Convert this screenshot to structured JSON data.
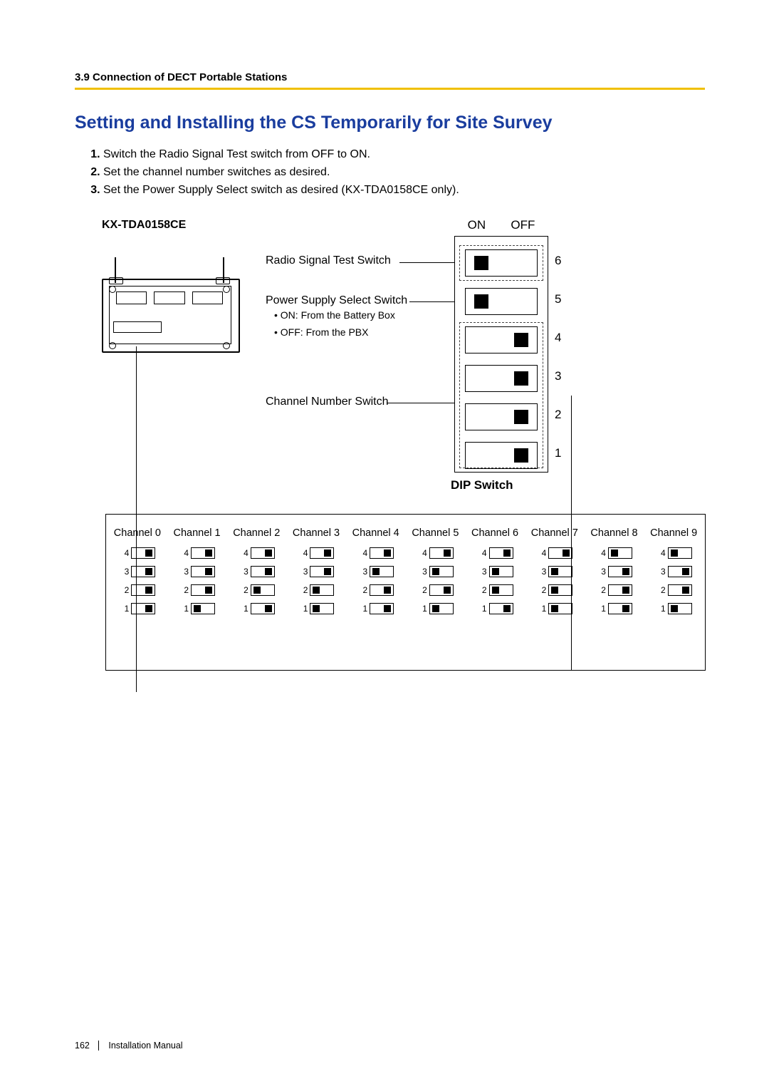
{
  "header": "3.9 Connection of DECT Portable Stations",
  "title": "Setting and Installing the CS Temporarily for Site Survey",
  "steps": [
    "Switch the Radio Signal Test switch from OFF to ON.",
    "Set the channel number switches as desired.",
    "Set the Power Supply Select switch as desired (KX-TDA0158CE only)."
  ],
  "model": "KX-TDA0158CE",
  "dip": {
    "on": "ON",
    "off": "OFF",
    "title": "DIP Switch",
    "radio_label": "Radio Signal Test Switch",
    "power_label": "Power Supply Select Switch",
    "power_sub1": "ON: From the Battery Box",
    "power_sub2": "OFF: From the PBX",
    "channel_label": "Channel Number Switch",
    "nums": {
      "1": "1",
      "2": "2",
      "3": "3",
      "4": "4",
      "5": "5",
      "6": "6"
    }
  },
  "channels": [
    {
      "name": "Channel 0",
      "sw": {
        "4": "off",
        "3": "off",
        "2": "off",
        "1": "off"
      }
    },
    {
      "name": "Channel 1",
      "sw": {
        "4": "off",
        "3": "off",
        "2": "off",
        "1": "on"
      }
    },
    {
      "name": "Channel 2",
      "sw": {
        "4": "off",
        "3": "off",
        "2": "on",
        "1": "off"
      }
    },
    {
      "name": "Channel 3",
      "sw": {
        "4": "off",
        "3": "off",
        "2": "on",
        "1": "on"
      }
    },
    {
      "name": "Channel 4",
      "sw": {
        "4": "off",
        "3": "on",
        "2": "off",
        "1": "off"
      }
    },
    {
      "name": "Channel 5",
      "sw": {
        "4": "off",
        "3": "on",
        "2": "off",
        "1": "on"
      }
    },
    {
      "name": "Channel 6",
      "sw": {
        "4": "off",
        "3": "on",
        "2": "on",
        "1": "off"
      }
    },
    {
      "name": "Channel 7",
      "sw": {
        "4": "off",
        "3": "on",
        "2": "on",
        "1": "on"
      }
    },
    {
      "name": "Channel 8",
      "sw": {
        "4": "on",
        "3": "off",
        "2": "off",
        "1": "off"
      }
    },
    {
      "name": "Channel 9",
      "sw": {
        "4": "on",
        "3": "off",
        "2": "off",
        "1": "on"
      }
    }
  ],
  "chart_data": {
    "type": "table",
    "title": "Channel Number Switch settings (DIP positions 1–4)",
    "columns": [
      "Channel",
      "Sw4",
      "Sw3",
      "Sw2",
      "Sw1"
    ],
    "rows": [
      [
        "Channel 0",
        "OFF",
        "OFF",
        "OFF",
        "OFF"
      ],
      [
        "Channel 1",
        "OFF",
        "OFF",
        "OFF",
        "ON"
      ],
      [
        "Channel 2",
        "OFF",
        "OFF",
        "ON",
        "OFF"
      ],
      [
        "Channel 3",
        "OFF",
        "OFF",
        "ON",
        "ON"
      ],
      [
        "Channel 4",
        "OFF",
        "ON",
        "OFF",
        "OFF"
      ],
      [
        "Channel 5",
        "OFF",
        "ON",
        "OFF",
        "ON"
      ],
      [
        "Channel 6",
        "OFF",
        "ON",
        "ON",
        "OFF"
      ],
      [
        "Channel 7",
        "OFF",
        "ON",
        "ON",
        "ON"
      ],
      [
        "Channel 8",
        "ON",
        "OFF",
        "OFF",
        "OFF"
      ],
      [
        "Channel 9",
        "ON",
        "OFF",
        "OFF",
        "ON"
      ]
    ],
    "main_dip": {
      "6": "ON",
      "5": "ON",
      "4": "OFF",
      "3": "OFF",
      "2": "OFF",
      "1": "OFF"
    }
  },
  "footer": {
    "page": "162",
    "doc": "Installation Manual"
  }
}
